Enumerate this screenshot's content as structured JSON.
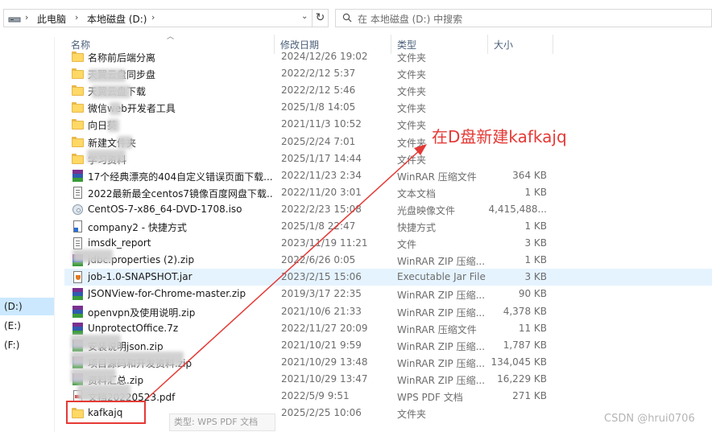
{
  "address": {
    "root": "此电脑",
    "drive": "本地磁盘 (D:)"
  },
  "search": {
    "placeholder": "在 本地磁盘 (D:) 中搜索"
  },
  "nav": {
    "items": [
      "(D:)",
      "(E:)",
      "(F:)"
    ],
    "selected": "(D:)"
  },
  "columns": {
    "name": "名称",
    "date": "修改日期",
    "type": "类型",
    "size": "大小"
  },
  "rows": [
    {
      "name": "名称前后端分离",
      "date": "2024/12/26 19:02",
      "type": "文件夹",
      "size": "",
      "icon": "folder-icon"
    },
    {
      "name": "天翼云盘同步盘",
      "date": "2022/2/12 5:37",
      "type": "文件夹",
      "size": "",
      "icon": "folder-icon"
    },
    {
      "name": "天翼云盘下载",
      "date": "2022/2/12 5:46",
      "type": "文件夹",
      "size": "",
      "icon": "folder-icon"
    },
    {
      "name": "微信web开发者工具",
      "date": "2025/1/8 14:05",
      "type": "文件夹",
      "size": "",
      "icon": "folder-icon"
    },
    {
      "name": "向日葵",
      "date": "2021/11/3 10:52",
      "type": "文件夹",
      "size": "",
      "icon": "folder-icon"
    },
    {
      "name": "新建文件夹",
      "date": "2025/2/24 7:01",
      "type": "文件夹",
      "size": "",
      "icon": "folder-icon"
    },
    {
      "name": "学习资料",
      "date": "2025/1/17 14:44",
      "type": "文件夹",
      "size": "",
      "icon": "folder-icon"
    },
    {
      "name": "17个经典漂亮的404自定义错误页面下载...",
      "date": "2022/11/23 2:34",
      "type": "WinRAR 压缩文件",
      "size": "364 KB",
      "icon": "rar-icon"
    },
    {
      "name": "2022最新最全centos7镜像百度网盘下载...",
      "date": "2022/11/20 3:01",
      "type": "文本文档",
      "size": "1 KB",
      "icon": "text-file-icon"
    },
    {
      "name": "CentOS-7-x86_64-DVD-1708.iso",
      "date": "2022/2/23 15:08",
      "type": "光盘映像文件",
      "size": "4,415,488...",
      "icon": "disc-image-icon"
    },
    {
      "name": "company2 - 快捷方式",
      "date": "2025/1/8 22:47",
      "type": "快捷方式",
      "size": "1 KB",
      "icon": "shortcut-icon"
    },
    {
      "name": "imsdk_report",
      "date": "2023/11/19 11:21",
      "type": "文件",
      "size": "3 KB",
      "icon": "file-icon"
    },
    {
      "name": "jdbc.properties (2).zip",
      "date": "2022/6/26 0:05",
      "type": "WinRAR ZIP 压缩...",
      "size": "1 KB",
      "icon": "zip-icon"
    },
    {
      "name": "job-1.0-SNAPSHOT.jar",
      "date": "2023/2/15 15:06",
      "type": "Executable Jar File",
      "size": "3 KB",
      "icon": "jar-icon"
    },
    {
      "name": "JSONView-for-Chrome-master.zip",
      "date": "2019/3/17 22:35",
      "type": "WinRAR ZIP 压缩...",
      "size": "90 KB",
      "icon": "zip-icon"
    },
    {
      "name": "openvpn及使用说明.zip",
      "date": "2021/10/6 21:33",
      "type": "WinRAR ZIP 压缩...",
      "size": "4,378 KB",
      "icon": "zip-icon"
    },
    {
      "name": "UnprotectOffice.7z",
      "date": "2022/11/27 20:09",
      "type": "WinRAR 压缩文件",
      "size": "11 KB",
      "icon": "rar-icon"
    },
    {
      "name": "安装说明json.zip",
      "date": "2021/10/21 9:59",
      "type": "WinRAR ZIP 压缩...",
      "size": "1,787 KB",
      "icon": "zip-icon"
    },
    {
      "name": "项目源码和开发资料.zip",
      "date": "2021/10/29 13:48",
      "type": "WinRAR ZIP 压缩...",
      "size": "134,045 KB",
      "icon": "zip-icon"
    },
    {
      "name": "资料汇总.zip",
      "date": "2021/10/29 13:47",
      "type": "WinRAR ZIP 压缩...",
      "size": "16,229 KB",
      "icon": "zip-icon"
    },
    {
      "name": "文档20220523.pdf",
      "date": "2022/5/9 9:51",
      "type": "WPS PDF 文档",
      "size": "271 KB",
      "icon": "pdf-icon"
    },
    {
      "name": "kafkajq",
      "date": "2025/2/25 10:06",
      "type": "文件夹",
      "size": "",
      "icon": "folder-icon"
    }
  ],
  "highlighted_row": "job-1.0-SNAPSHOT.jar",
  "annotation": {
    "text": "在D盘新建kafkajq",
    "color": "#e53935"
  },
  "tooltip": {
    "text": "类型: WPS PDF 文档"
  },
  "watermark": {
    "text": "CSDN @hrui0706"
  },
  "colors": {
    "accent_select": "#cce8ff",
    "row_hover": "#e5f3ff",
    "folder": "#ffd866",
    "annotation": "#e53935"
  }
}
